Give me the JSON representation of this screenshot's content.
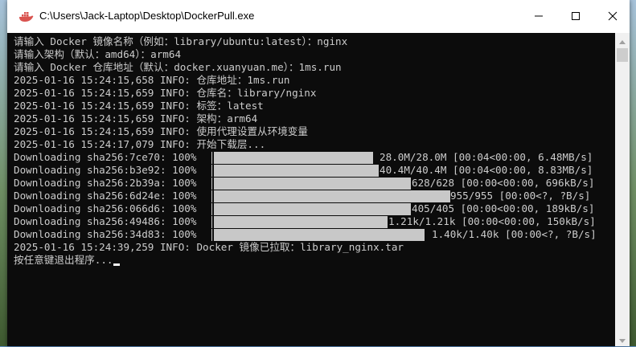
{
  "window": {
    "title": "C:\\Users\\Jack-Laptop\\Desktop\\DockerPull.exe",
    "icon": "docker-whale-icon"
  },
  "console": {
    "lines": [
      "请输入 Docker 镜像名称（例如：library/ubuntu:latest）：nginx",
      "请输入架构（默认：amd64）：arm64",
      "请输入 Docker 仓库地址（默认：docker.xuanyuan.me）：1ms.run",
      "2025-01-16 15:24:15,658 INFO: 仓库地址：1ms.run",
      "2025-01-16 15:24:15,659 INFO: 仓库名：library/nginx",
      "2025-01-16 15:24:15,659 INFO: 标签：latest",
      "2025-01-16 15:24:15,659 INFO: 架构：arm64",
      "2025-01-16 15:24:15,659 INFO: 使用代理设置从环境变量",
      "2025-01-16 15:24:17,079 INFO: 开始下载层..."
    ],
    "downloads": [
      {
        "label": "Downloading sha256:7ce70: 100%",
        "progress": 1.0,
        "stats": "28.0M/28.0M [00:04<00:00, 6.48MB/s]"
      },
      {
        "label": "Downloading sha256:b3e92: 100%",
        "progress": 1.0,
        "stats": "40.4M/40.4M [00:04<00:00, 8.83MB/s]"
      },
      {
        "label": "Downloading sha256:2b39a: 100%",
        "progress": 1.0,
        "stats": "628/628 [00:00<00:00, 696kB/s]"
      },
      {
        "label": "Downloading sha256:6d24e: 100%",
        "progress": 1.0,
        "stats": "955/955 [00:00<?, ?B/s]"
      },
      {
        "label": "Downloading sha256:066d6: 100%",
        "progress": 1.0,
        "stats": "405/405 [00:00<00:00, 189kB/s]"
      },
      {
        "label": "Downloading sha256:49486: 100%",
        "progress": 1.0,
        "stats": "1.21k/1.21k [00:00<00:00, 150kB/s]"
      },
      {
        "label": "Downloading sha256:34d83: 100%",
        "progress": 1.0,
        "stats": "1.40k/1.40k [00:00<?, ?B/s]"
      }
    ],
    "final_lines": [
      "2025-01-16 15:24:39,259 INFO: Docker 镜像已拉取：library_nginx.tar",
      "按任意键退出程序..."
    ]
  },
  "colors": {
    "console_bg": "#0c0c0c",
    "console_text": "#cccccc",
    "progress_fill": "#c8c8c8"
  }
}
